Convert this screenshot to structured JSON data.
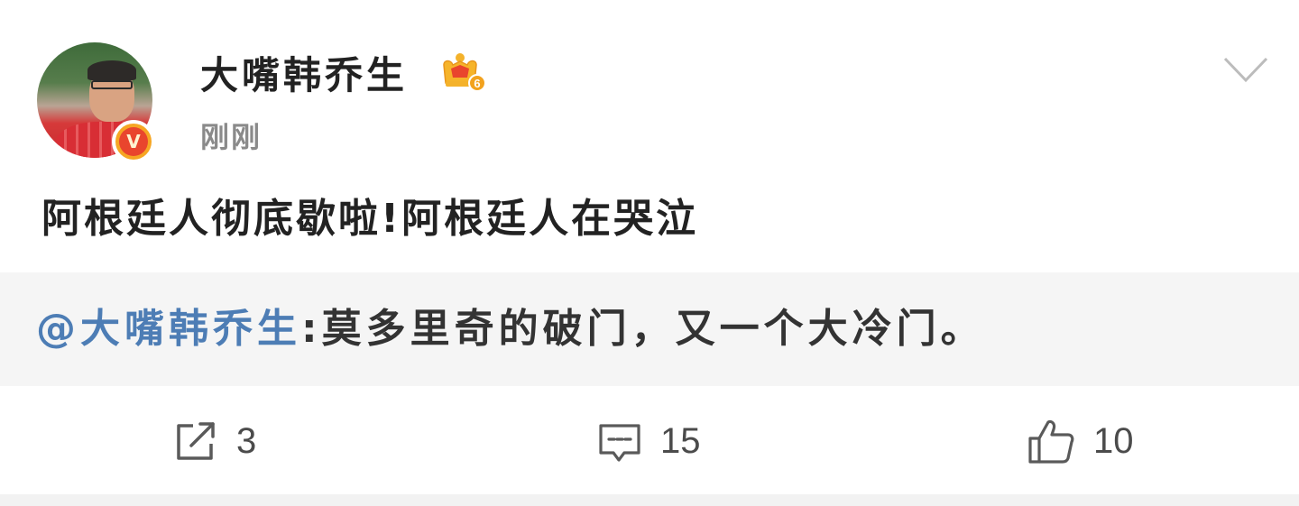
{
  "post": {
    "author": {
      "name": "大嘴韩乔生",
      "avatar_icon": "avatar-photo",
      "verified_badge": "V",
      "member_level": "6"
    },
    "time": "刚刚",
    "text": "阿根廷人彻底歇啦!阿根廷人在哭泣",
    "repost": {
      "mention": "@大嘴韩乔生",
      "text": ":莫多里奇的破门，又一个大冷门。"
    },
    "actions": {
      "share_count": "3",
      "comment_count": "15",
      "like_count": "10"
    }
  },
  "colors": {
    "mention": "#4d7db5",
    "text": "#222222",
    "muted": "#8a8a8a",
    "badge_orange": "#f6a623",
    "badge_red": "#e9452d"
  }
}
